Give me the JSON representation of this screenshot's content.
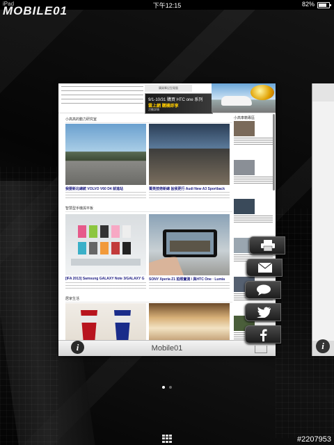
{
  "statusbar": {
    "carrier": "iPad",
    "time": "下午12:15",
    "battery_pct": "82%",
    "battery_level": 0.82
  },
  "app": {
    "logo": "MOBILE01",
    "card_title": "Mobile01"
  },
  "ad": {
    "small_text": "購買筆記型電腦",
    "banner_line1": "9/1-10/31 購買 HTC one 系列",
    "banner_line2": "雲上網 購機即享",
    "banner_line3": "活動詳情"
  },
  "content": {
    "section_1": "小高高的動力研究室",
    "section_2": "智慧型手機與平板",
    "section_3": "居家生活",
    "sidebar_title": "小高車籍專區",
    "articles": [
      {
        "caption": "我要新北總統 VOLVO V60 D4 就進站"
      },
      {
        "caption": "菁英技術新總 旨我更行 Audi New A3 Sportback"
      },
      {
        "caption": "[IFA 2013] Samsung GALAXY Note 3/GALAXY G"
      },
      {
        "caption": "SONY Xperia Z1 拍照實測 / 與HTC One · Lumia"
      },
      {
        "caption": ""
      },
      {
        "caption": ""
      }
    ]
  },
  "share": {
    "buttons": [
      "print",
      "email",
      "message",
      "twitter",
      "facebook"
    ]
  },
  "pager": {
    "current": 1,
    "total": 2
  },
  "watermark": "#2207953"
}
